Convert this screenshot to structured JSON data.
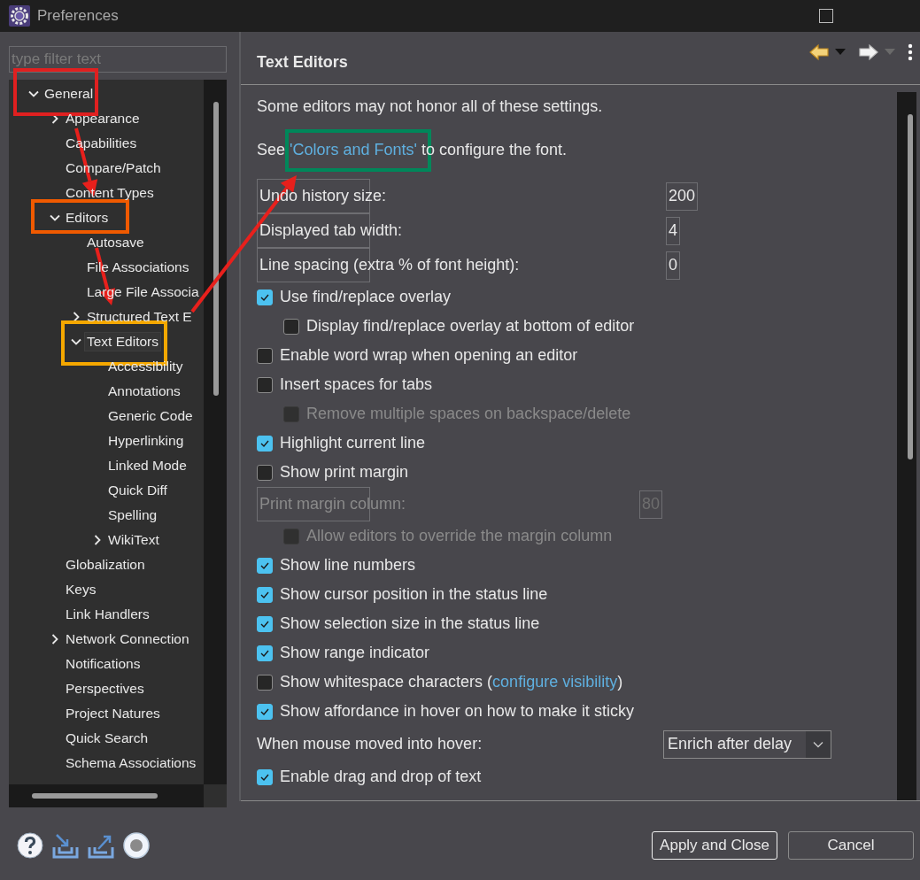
{
  "window": {
    "title": "Preferences"
  },
  "filter": {
    "placeholder": "type filter text"
  },
  "tree": [
    {
      "label": "General",
      "expanded": true,
      "selected": false,
      "children": [
        {
          "label": "Appearance",
          "expanded": false,
          "selected": false
        },
        {
          "label": "Capabilities",
          "selected": false
        },
        {
          "label": "Compare/Patch",
          "selected": false
        },
        {
          "label": "Content Types",
          "selected": false
        },
        {
          "label": "Editors",
          "expanded": true,
          "selected": false,
          "children": [
            {
              "label": "Autosave",
              "selected": false
            },
            {
              "label": "File Associations",
              "selected": false
            },
            {
              "label": "Large File Associa",
              "selected": false
            },
            {
              "label": "Structured Text E",
              "expanded": false,
              "selected": false
            },
            {
              "label": "Text Editors",
              "expanded": true,
              "selected": true,
              "children": [
                {
                  "label": "Accessibility",
                  "selected": false
                },
                {
                  "label": "Annotations",
                  "selected": false
                },
                {
                  "label": "Generic Code",
                  "selected": false
                },
                {
                  "label": "Hyperlinking",
                  "selected": false
                },
                {
                  "label": "Linked Mode",
                  "selected": false
                },
                {
                  "label": "Quick Diff",
                  "selected": false
                },
                {
                  "label": "Spelling",
                  "selected": false
                },
                {
                  "label": "WikiText",
                  "expanded": false,
                  "selected": false
                }
              ]
            }
          ]
        },
        {
          "label": "Globalization",
          "selected": false
        },
        {
          "label": "Keys",
          "selected": false
        },
        {
          "label": "Link Handlers",
          "selected": false
        },
        {
          "label": "Network Connection",
          "expanded": false,
          "selected": false
        },
        {
          "label": "Notifications",
          "selected": false
        },
        {
          "label": "Perspectives",
          "selected": false
        },
        {
          "label": "Project Natures",
          "selected": false
        },
        {
          "label": "Quick Search",
          "selected": false
        },
        {
          "label": "Schema Associations",
          "selected": false
        }
      ]
    }
  ],
  "page": {
    "title": "Text Editors",
    "rows": [
      {
        "kind": "text",
        "text": "Some editors may not honor all of these settings."
      },
      {
        "kind": "text_with_link",
        "before": "See ",
        "link": "'Colors and Fonts'",
        "after": " to configure the font."
      },
      {
        "kind": "number_field",
        "label": "Undo history size:",
        "value": "200",
        "disabled": false
      },
      {
        "kind": "number_field",
        "label": "Displayed tab width:",
        "value": "4",
        "disabled": false
      },
      {
        "kind": "number_field",
        "label": "Line spacing (extra % of font height):",
        "value": "0",
        "disabled": false
      },
      {
        "kind": "checkbox",
        "label": "Use find/replace overlay",
        "checked": true,
        "disabled": false,
        "children": [
          {
            "kind": "checkbox",
            "label": "Display find/replace overlay at bottom of editor",
            "checked": false,
            "disabled": false
          }
        ]
      },
      {
        "kind": "checkbox",
        "label": "Enable word wrap when opening an editor",
        "checked": false,
        "disabled": false
      },
      {
        "kind": "checkbox",
        "label": "Insert spaces for tabs",
        "checked": false,
        "disabled": false,
        "children": [
          {
            "kind": "checkbox",
            "label": "Remove multiple spaces on backspace/delete",
            "checked": false,
            "disabled": true
          }
        ]
      },
      {
        "kind": "checkbox",
        "label": "Highlight current line",
        "checked": true,
        "disabled": false
      },
      {
        "kind": "checkbox",
        "label": "Show print margin",
        "checked": false,
        "disabled": false,
        "children": [
          {
            "kind": "number_field",
            "label": "Print margin column:",
            "value": "80",
            "disabled": true
          },
          {
            "kind": "checkbox",
            "label": "Allow editors to override the margin column",
            "checked": false,
            "disabled": true
          }
        ]
      },
      {
        "kind": "checkbox",
        "label": "Show line numbers",
        "checked": true,
        "disabled": false
      },
      {
        "kind": "checkbox",
        "label": "Show cursor position in the status line",
        "checked": true,
        "disabled": false
      },
      {
        "kind": "checkbox",
        "label": "Show selection size in the status line",
        "checked": true,
        "disabled": false
      },
      {
        "kind": "checkbox",
        "label": "Show range indicator",
        "checked": true,
        "disabled": false
      },
      {
        "kind": "checkbox",
        "label": "Show whitespace characters (",
        "link": "configure visibility",
        "after": ")",
        "checked": false,
        "disabled": false
      },
      {
        "kind": "checkbox",
        "label": "Show affordance in hover on how to make it sticky",
        "checked": true,
        "disabled": false
      },
      {
        "kind": "dropdown",
        "label": "When mouse moved into hover:",
        "value": "Enrich after delay"
      },
      {
        "kind": "checkbox",
        "label": "Enable drag and drop of text",
        "checked": true,
        "disabled": false
      }
    ]
  },
  "buttons": [
    {
      "label": "Apply and Close",
      "default": true
    },
    {
      "label": "Cancel",
      "default": false
    }
  ]
}
